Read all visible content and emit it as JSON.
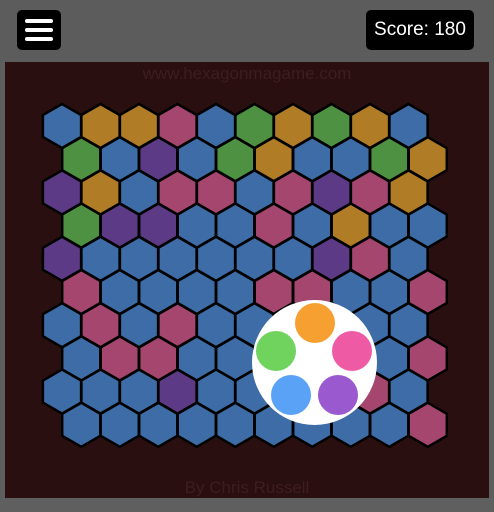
{
  "header": {
    "score_text": "Score: 180",
    "menu_icon": "hamburger-menu-icon"
  },
  "site_text": "www.hexagonmagame.com",
  "credit_text": "By Chris Russell",
  "colors": {
    "B": "#3d6ca6",
    "O": "#b07c25",
    "M": "#a5466f",
    "G": "#4f9143",
    "P": "#5c3a85"
  },
  "board": {
    "rows": [
      "BOOMBGOGOB",
      "GBPBGOBBGO",
      "POBMMBMPMO",
      "GPPBBMBOBB",
      "PBBBBBBPMB",
      "MBBBBMMBBM",
      "BMBMBBMBBB",
      "BMMBBBBBBM",
      "BBBPBBBBMB",
      "BBBBBBBBBM"
    ]
  },
  "color_picker": {
    "options": [
      {
        "name": "orange",
        "color": "#f7a032"
      },
      {
        "name": "pink",
        "color": "#ef5aa5"
      },
      {
        "name": "purple",
        "color": "#9a59cf"
      },
      {
        "name": "blue",
        "color": "#5aa2f5"
      },
      {
        "name": "green",
        "color": "#6fd35d"
      }
    ]
  }
}
